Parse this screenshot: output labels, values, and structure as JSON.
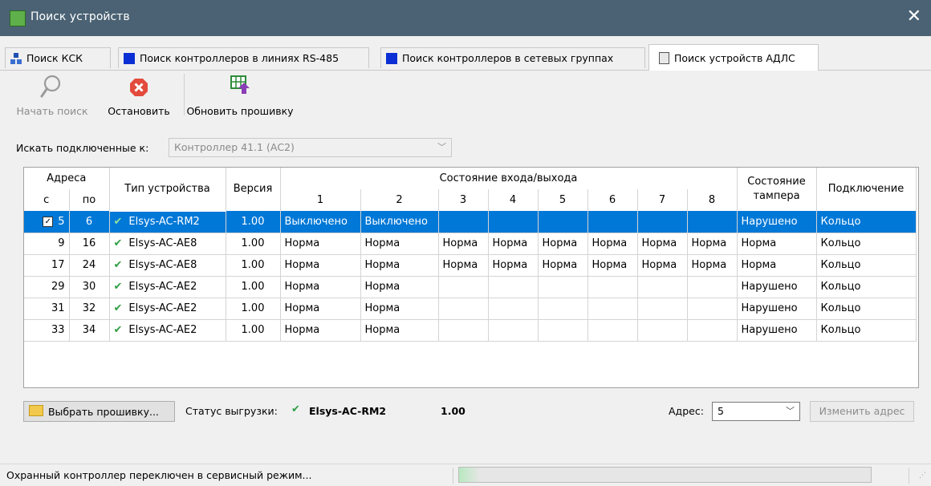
{
  "window": {
    "title": "Поиск устройств",
    "close_glyph": "✕"
  },
  "tabs": [
    {
      "label": "Поиск КСК",
      "icon": "network-icon"
    },
    {
      "label": "Поиск контроллеров в линиях RS-485",
      "icon": "controller-icon"
    },
    {
      "label": "Поиск контроллеров в сетевых группах",
      "icon": "controller-icon"
    },
    {
      "label": "Поиск устройств АДЛС",
      "icon": "terminal-icon",
      "active": true
    }
  ],
  "toolbar": {
    "start_label": "Начать поиск",
    "stop_label": "Остановить",
    "update_label": "Обновить прошивку"
  },
  "search": {
    "label": "Искать подключенные к:",
    "selected": "Контроллер 41.1 (АС2)"
  },
  "table": {
    "group_address": "Адреса",
    "col_from": "с",
    "col_to": "по",
    "col_type": "Тип устройства",
    "col_version": "Версия",
    "group_io": "Состояние входа/выхода",
    "io_numbers": [
      "1",
      "2",
      "3",
      "4",
      "5",
      "6",
      "7",
      "8"
    ],
    "col_tamper_1": "Состояние",
    "col_tamper_2": "тампера",
    "col_connection": "Подключение",
    "rows": [
      {
        "from": "5",
        "to": "6",
        "type": "Elsys-AC-RM2",
        "version": "1.00",
        "io": [
          "Выключено",
          "Выключено",
          "",
          "",
          "",
          "",
          "",
          ""
        ],
        "tamper": "Нарушено",
        "connection": "Кольцо",
        "selected": true,
        "checked": true
      },
      {
        "from": "9",
        "to": "16",
        "type": "Elsys-AC-AE8",
        "version": "1.00",
        "io": [
          "Норма",
          "Норма",
          "Норма",
          "Норма",
          "Норма",
          "Норма",
          "Норма",
          "Норма"
        ],
        "tamper": "Норма",
        "connection": "Кольцо"
      },
      {
        "from": "17",
        "to": "24",
        "type": "Elsys-AC-AE8",
        "version": "1.00",
        "io": [
          "Норма",
          "Норма",
          "Норма",
          "Норма",
          "Норма",
          "Норма",
          "Норма",
          "Норма"
        ],
        "tamper": "Норма",
        "connection": "Кольцо"
      },
      {
        "from": "29",
        "to": "30",
        "type": "Elsys-AC-AE2",
        "version": "1.00",
        "io": [
          "Норма",
          "Норма",
          "",
          "",
          "",
          "",
          "",
          ""
        ],
        "tamper": "Нарушено",
        "connection": "Кольцо"
      },
      {
        "from": "31",
        "to": "32",
        "type": "Elsys-AC-AE2",
        "version": "1.00",
        "io": [
          "Норма",
          "Норма",
          "",
          "",
          "",
          "",
          "",
          ""
        ],
        "tamper": "Нарушено",
        "connection": "Кольцо"
      },
      {
        "from": "33",
        "to": "34",
        "type": "Elsys-AC-AE2",
        "version": "1.00",
        "io": [
          "Норма",
          "Норма",
          "",
          "",
          "",
          "",
          "",
          ""
        ],
        "tamper": "Нарушено",
        "connection": "Кольцо"
      }
    ]
  },
  "bottom": {
    "select_firmware": "Выбрать прошивку...",
    "upload_status_label": "Статус выгрузки:",
    "upload_device": "Elsys-AC-RM2",
    "upload_version": "1.00",
    "address_label": "Адрес:",
    "address_value": "5",
    "change_address": "Изменить адрес"
  },
  "status": {
    "message": "Охранный контроллер переключен в сервисный режим...",
    "progress_percent": 5
  },
  "colors": {
    "titlebar": "#4a6273",
    "selection": "#0078d7",
    "ok_check": "#2f9e44",
    "stop": "#e34b3d"
  }
}
